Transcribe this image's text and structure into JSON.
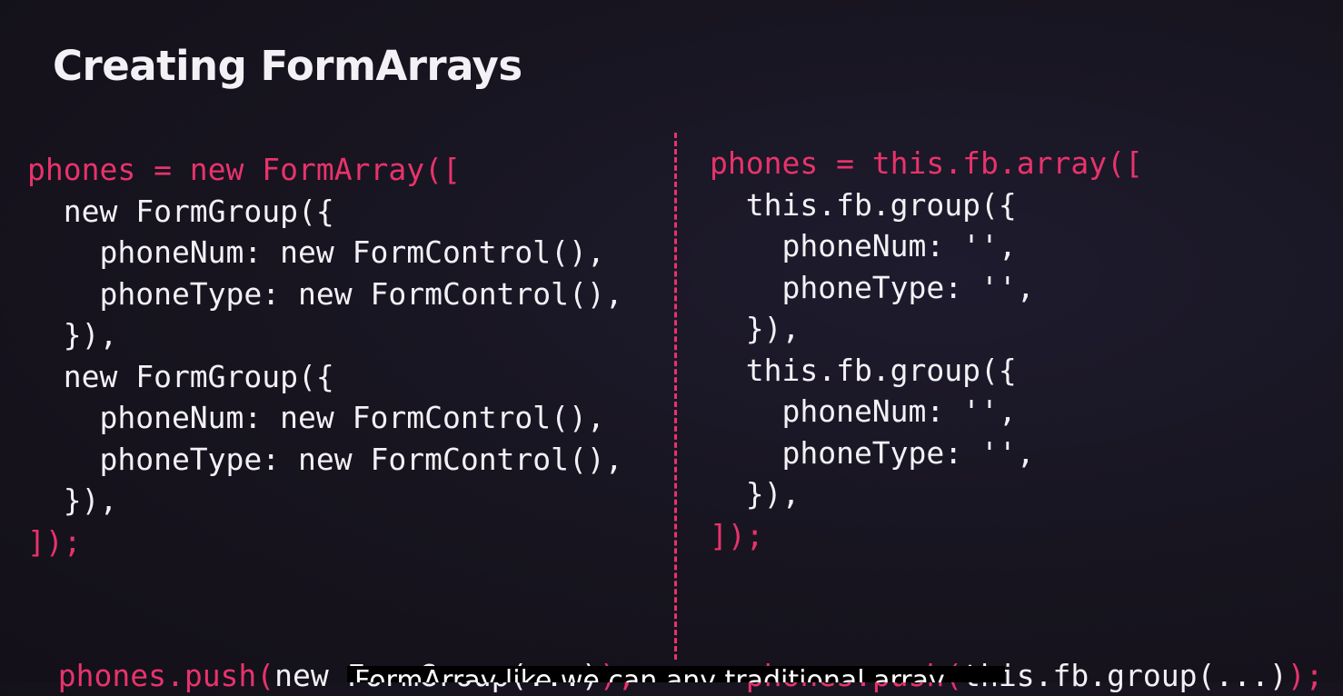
{
  "slide": {
    "title": "Creating FormArrays"
  },
  "left": {
    "lines": [
      {
        "text": "phones = new FormArray([",
        "color": "pink"
      },
      {
        "text": "  new FormGroup({",
        "color": "white"
      },
      {
        "text": "    phoneNum: new FormControl(),",
        "color": "white"
      },
      {
        "text": "    phoneType: new FormControl(),",
        "color": "white"
      },
      {
        "text": "  }),",
        "color": "white"
      },
      {
        "text": "  new FormGroup({",
        "color": "white"
      },
      {
        "text": "    phoneNum: new FormControl(),",
        "color": "white"
      },
      {
        "text": "    phoneType: new FormControl(),",
        "color": "white"
      },
      {
        "text": "  }),",
        "color": "white"
      },
      {
        "text": "]);",
        "color": "pink"
      }
    ],
    "push": {
      "prefix": "phones.push(",
      "arg": "new FormGroup(...)",
      "suffix": ");"
    }
  },
  "right": {
    "lines": [
      {
        "text": "phones = this.fb.array([",
        "color": "pink"
      },
      {
        "text": "  this.fb.group({",
        "color": "white"
      },
      {
        "text": "    phoneNum: '',",
        "color": "white"
      },
      {
        "text": "    phoneType: '',",
        "color": "white"
      },
      {
        "text": "  }),",
        "color": "white"
      },
      {
        "text": "  this.fb.group({",
        "color": "white"
      },
      {
        "text": "    phoneNum: '',",
        "color": "white"
      },
      {
        "text": "    phoneType: '',",
        "color": "white"
      },
      {
        "text": "  }),",
        "color": "white"
      },
      {
        "text": "]);",
        "color": "pink"
      }
    ],
    "push": {
      "prefix": "phones.push(",
      "arg": "this.fb.group(...)",
      "suffix": ");"
    }
  },
  "caption": {
    "text": "FormArray like we can any traditional array"
  },
  "colors": {
    "accent": "#e8336b",
    "text": "#f3f1f6",
    "background": "#17141f"
  }
}
